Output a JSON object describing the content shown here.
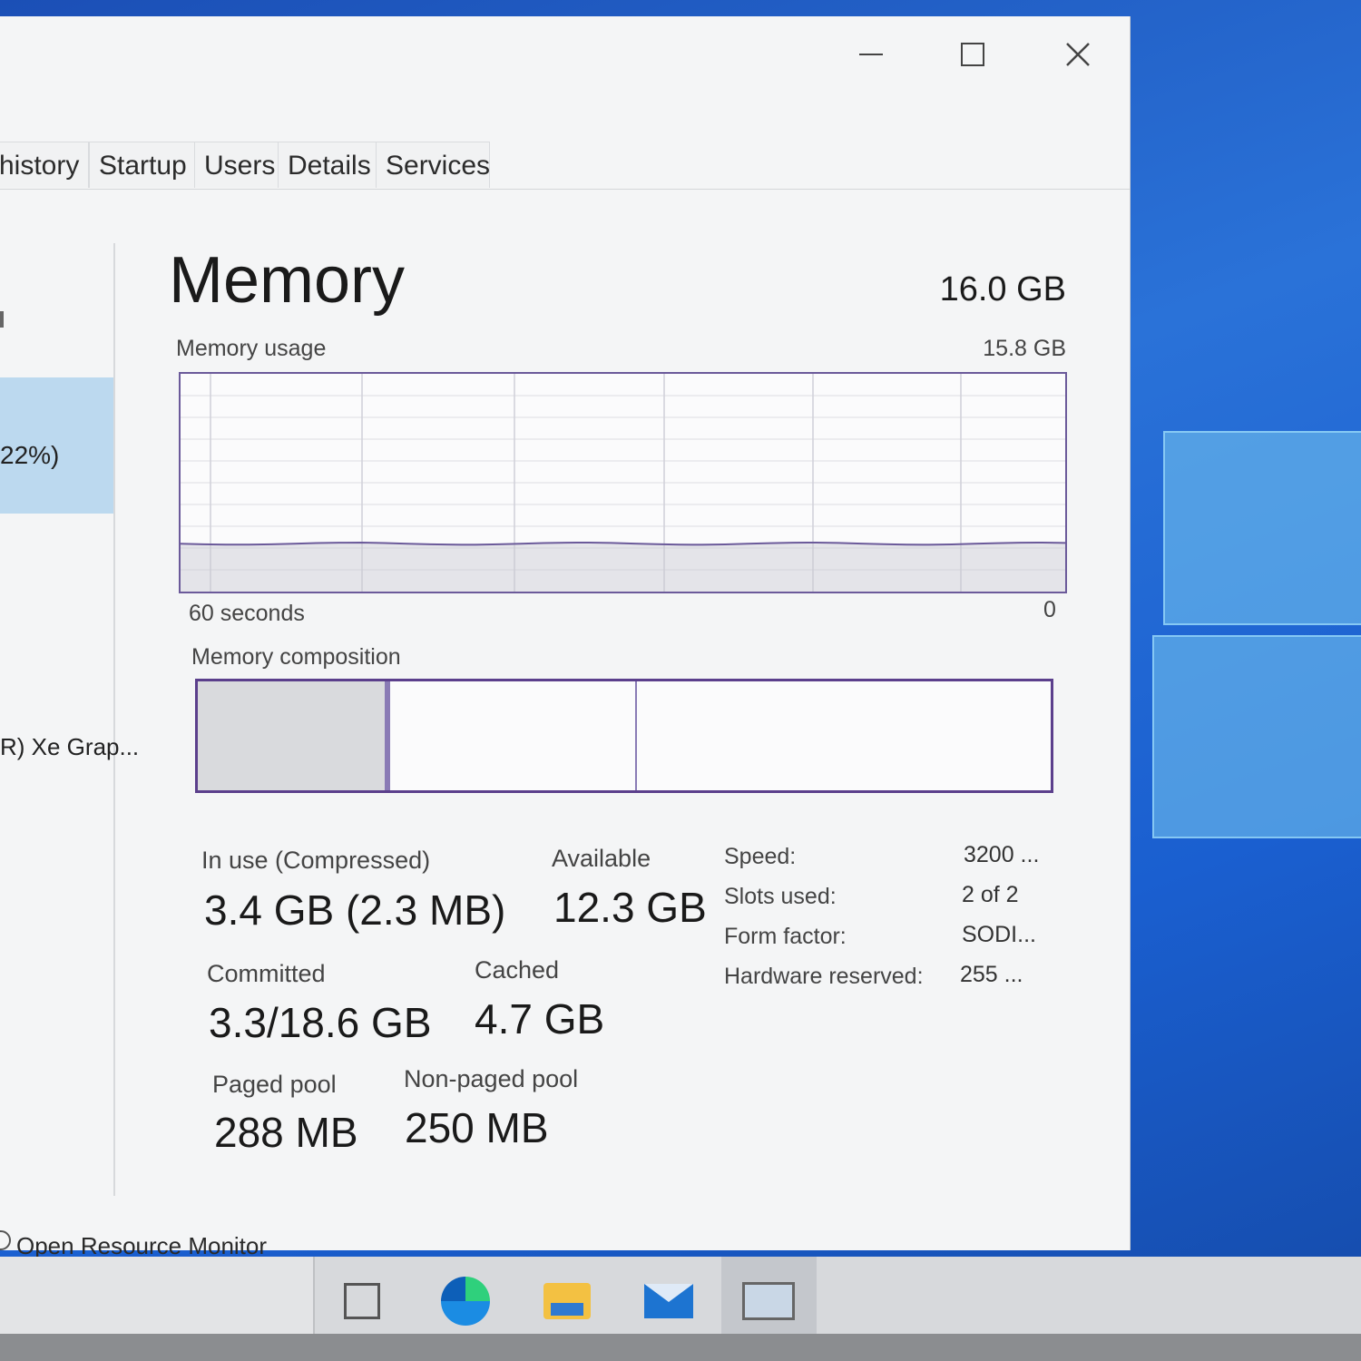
{
  "window": {
    "controls": {
      "minimize": "minimize",
      "maximize": "maximize",
      "close": "✕"
    }
  },
  "tabs": [
    {
      "label": "history"
    },
    {
      "label": "Startup"
    },
    {
      "label": "Users"
    },
    {
      "label": "Details"
    },
    {
      "label": "Services"
    }
  ],
  "sidebar": {
    "selected_partial": "22%)",
    "gpu_partial": "R) Xe Grap..."
  },
  "memory": {
    "title": "Memory",
    "total": "16.0 GB",
    "usage_label": "Memory usage",
    "usage_max": "15.8 GB",
    "time_left": "60 seconds",
    "time_right": "0",
    "composition_label": "Memory composition",
    "usage_fraction": 0.22
  },
  "stats": {
    "in_use_label": "In use (Compressed)",
    "in_use_value": "3.4 GB (2.3 MB)",
    "available_label": "Available",
    "available_value": "12.3 GB",
    "committed_label": "Committed",
    "committed_value": "3.3/18.6 GB",
    "cached_label": "Cached",
    "cached_value": "4.7 GB",
    "paged_label": "Paged pool",
    "paged_value": "288 MB",
    "nonpaged_label": "Non-paged pool",
    "nonpaged_value": "250 MB"
  },
  "specs": [
    {
      "label": "Speed:",
      "value": "3200 ..."
    },
    {
      "label": "Slots used:",
      "value": "2 of 2"
    },
    {
      "label": "Form factor:",
      "value": "SODI..."
    },
    {
      "label": "Hardware reserved:",
      "value": "255 ..."
    }
  ],
  "footer": {
    "link": "Open Resource Monitor"
  },
  "taskbar": {
    "icons": [
      "task-view-icon",
      "edge-icon",
      "file-explorer-icon",
      "mail-icon",
      "task-manager-icon"
    ]
  }
}
